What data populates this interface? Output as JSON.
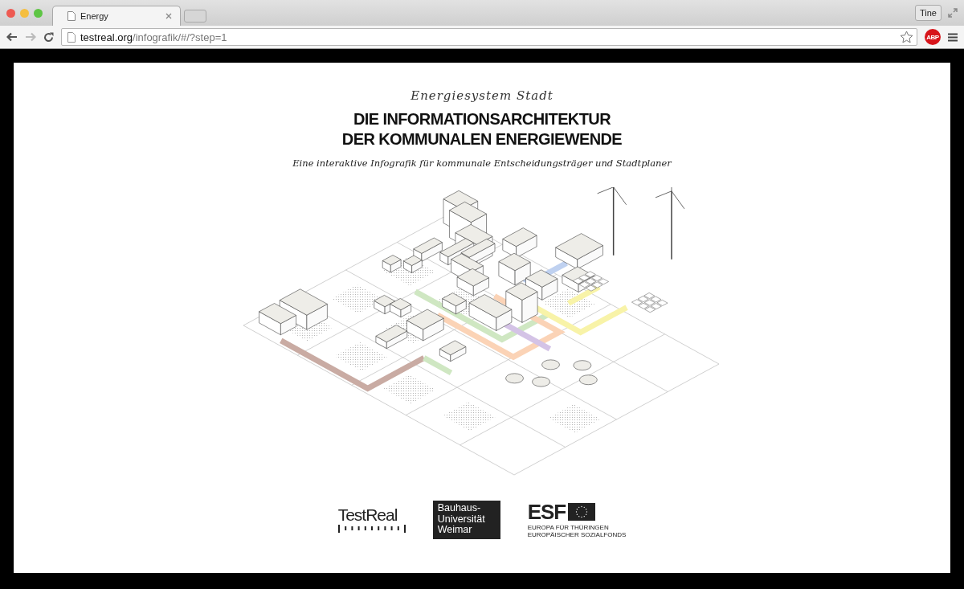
{
  "browser": {
    "tabs": [
      {
        "title": "Energy",
        "selected": true
      }
    ],
    "profile": "Tine",
    "url": {
      "host": "testreal.org",
      "path": "/infografik/#/?step=1"
    },
    "extension_badge": "ABP"
  },
  "page": {
    "kicker": "Energiesystem Stadt",
    "headline": [
      "DIE INFORMATIONSARCHITEKTUR",
      "DER KOMMUNALEN ENERGIEWENDE"
    ],
    "subtitle": "Eine interaktive Infografik für kommunale Entscheidungsträger und Stadtplaner",
    "logos": [
      {
        "kind": "wordmark",
        "text": "TestReal"
      },
      {
        "kind": "block",
        "lines": [
          "Bauhaus-",
          "Universität",
          "Weimar"
        ]
      },
      {
        "kind": "esf",
        "text": "ESF",
        "lines": [
          "EUROPA FÜR THÜRINGEN",
          "EUROPÄISCHER SOZIALFONDS"
        ]
      }
    ]
  }
}
